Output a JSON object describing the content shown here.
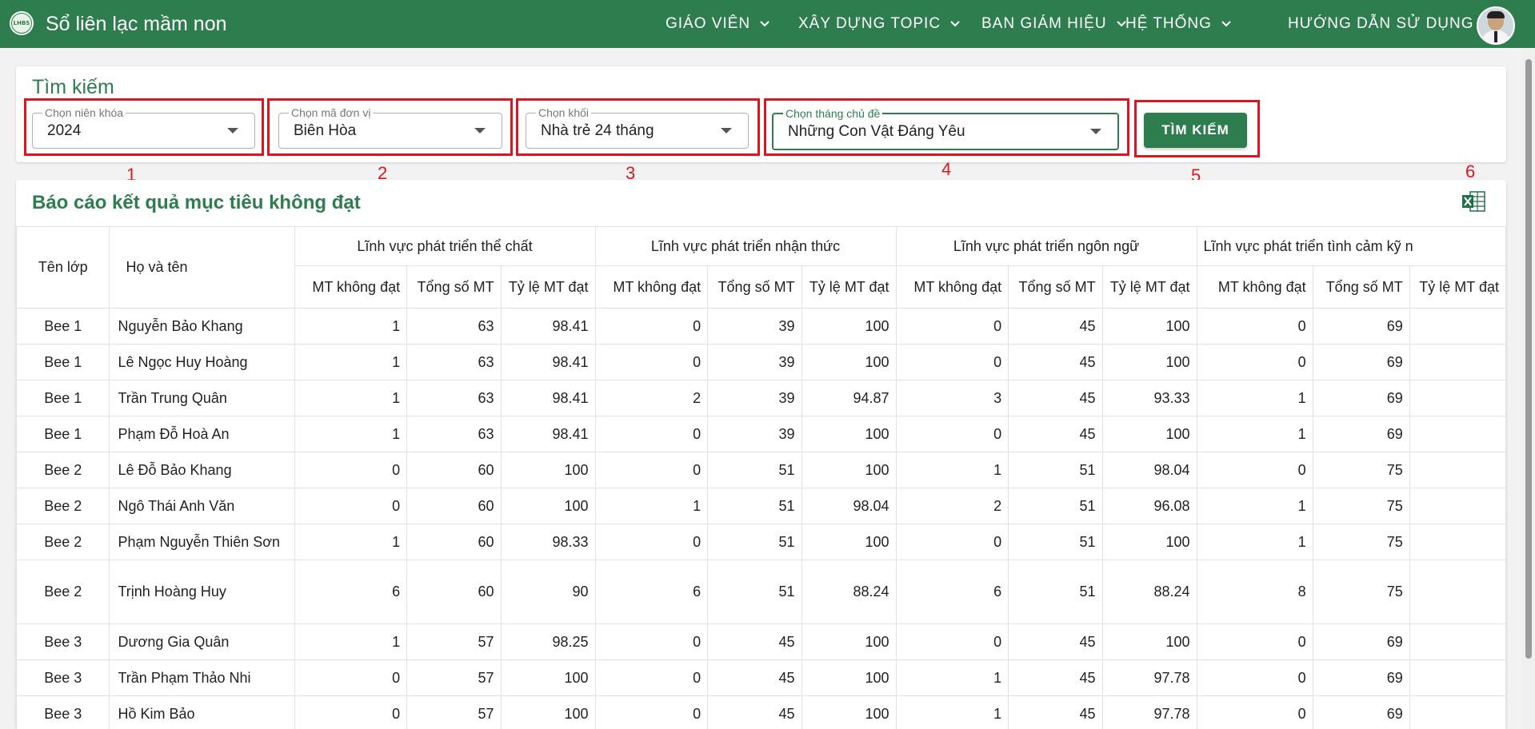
{
  "header": {
    "logo_text": "LHBS",
    "title": "Sổ liên lạc mầm non",
    "nav": [
      "GIÁO VIÊN",
      "XÂY DỰNG TOPIC",
      "BAN GIÁM HIỆU",
      "HỆ THỐNG",
      "HƯỚNG DẪN SỬ DỤNG"
    ],
    "colors": {
      "primary": "#2e7d4f",
      "annotation": "#e0141e"
    }
  },
  "search": {
    "title": "Tìm kiếm",
    "fields": [
      {
        "label": "Chọn niên khóa",
        "value": "2024"
      },
      {
        "label": "Chọn mã đơn vị",
        "value": "Biên Hòa"
      },
      {
        "label": "Chọn khối",
        "value": "Nhà trẻ 24 tháng"
      },
      {
        "label": "Chọn tháng chủ đề",
        "value": "Những Con Vật Đáng Yêu"
      }
    ],
    "button": "TÌM KIẾM"
  },
  "annotations": [
    "1",
    "2",
    "3",
    "4",
    "5",
    "6"
  ],
  "report": {
    "title": "Báo cáo kết quả mục tiêu không đạt",
    "export_icon": "excel-export-icon",
    "col_class": "Tên lớp",
    "col_name": "Họ và tên",
    "groups": [
      "Lĩnh vực phát triển thể chất",
      "Lĩnh vực phát triển nhận thức",
      "Lĩnh vực phát triển ngôn ngữ",
      "Lĩnh vực phát triển tình cảm kỹ n"
    ],
    "sub": [
      "MT không đạt",
      "Tổng số MT",
      "Tỷ lệ MT đạt"
    ],
    "rows": [
      {
        "cls": "Bee 1",
        "name": "Nguyễn Bảo Khang",
        "v": [
          "1",
          "63",
          "98.41",
          "0",
          "39",
          "100",
          "0",
          "45",
          "100",
          "0",
          "69"
        ]
      },
      {
        "cls": "Bee 1",
        "name": "Lê Ngọc Huy Hoàng",
        "v": [
          "1",
          "63",
          "98.41",
          "0",
          "39",
          "100",
          "0",
          "45",
          "100",
          "0",
          "69"
        ]
      },
      {
        "cls": "Bee 1",
        "name": "Trần Trung Quân",
        "v": [
          "1",
          "63",
          "98.41",
          "2",
          "39",
          "94.87",
          "3",
          "45",
          "93.33",
          "1",
          "69"
        ]
      },
      {
        "cls": "Bee 1",
        "name": "Phạm Đỗ Hoà An",
        "v": [
          "1",
          "63",
          "98.41",
          "0",
          "39",
          "100",
          "0",
          "45",
          "100",
          "1",
          "69"
        ]
      },
      {
        "cls": "Bee 2",
        "name": "Lê Đỗ Bảo Khang",
        "v": [
          "0",
          "60",
          "100",
          "0",
          "51",
          "100",
          "1",
          "51",
          "98.04",
          "0",
          "75"
        ]
      },
      {
        "cls": "Bee 2",
        "name": "Ngô Thái Anh Văn",
        "v": [
          "0",
          "60",
          "100",
          "1",
          "51",
          "98.04",
          "2",
          "51",
          "96.08",
          "1",
          "75"
        ]
      },
      {
        "cls": "Bee 2",
        "name": "Phạm Nguyễn Thiên Sơn",
        "v": [
          "1",
          "60",
          "98.33",
          "0",
          "51",
          "100",
          "0",
          "51",
          "100",
          "1",
          "75"
        ]
      },
      {
        "cls": "Bee 2",
        "name": "Trịnh Hoàng Huy",
        "v": [
          "6",
          "60",
          "90",
          "6",
          "51",
          "88.24",
          "6",
          "51",
          "88.24",
          "8",
          "75"
        ]
      },
      {
        "cls": "Bee 3",
        "name": "Dương Gia Quân",
        "v": [
          "1",
          "57",
          "98.25",
          "0",
          "45",
          "100",
          "0",
          "45",
          "100",
          "0",
          "69"
        ]
      },
      {
        "cls": "Bee 3",
        "name": "Trần Phạm Thảo Nhi",
        "v": [
          "0",
          "57",
          "100",
          "0",
          "45",
          "100",
          "1",
          "45",
          "97.78",
          "0",
          "69"
        ]
      },
      {
        "cls": "Bee 3",
        "name": "Hồ Kim Bảo",
        "v": [
          "0",
          "57",
          "100",
          "0",
          "45",
          "100",
          "1",
          "45",
          "97.78",
          "0",
          "69"
        ]
      }
    ]
  }
}
